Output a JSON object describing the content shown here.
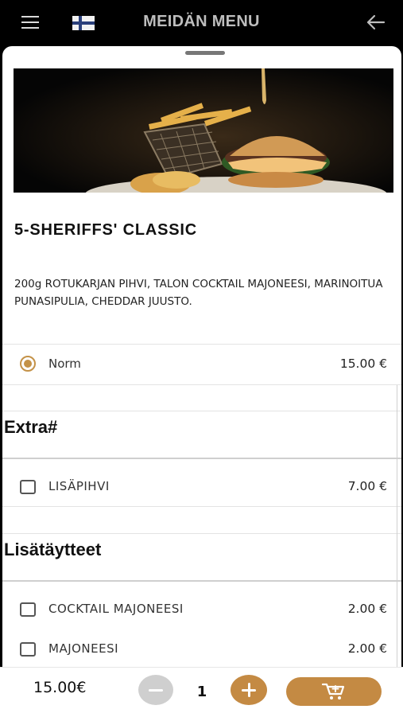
{
  "header": {
    "title": "MEIDÄN MENU",
    "menu_icon": "hamburger-menu-icon",
    "language_icon": "finland-flag-icon",
    "back_icon": "arrow-left-icon"
  },
  "product": {
    "image": "burger-and-fries-photo",
    "title": "5-SHERIFFS' CLASSIC",
    "description": "200g ROTUKARJAN PIHVI, TALON COCKTAIL MAJONEESI, MARINOITUA PUNASIPULIA, CHEDDAR JUUSTO."
  },
  "size_options": [
    {
      "label": "Norm",
      "price": "15.00 €",
      "selected": true
    }
  ],
  "sections": [
    {
      "title": "Extra#",
      "options": [
        {
          "label": "LISÄPIHVI",
          "price": "7.00 €",
          "checked": false
        }
      ]
    },
    {
      "title": "Lisätäytteet",
      "options": [
        {
          "label": "COCKTAIL MAJONEESI",
          "price": "2.00 €",
          "checked": false
        },
        {
          "label": "MAJONEESI",
          "price": "2.00 €",
          "checked": false
        }
      ]
    }
  ],
  "footer": {
    "total": "15.00€",
    "quantity": "1",
    "minus_icon": "minus-icon",
    "plus_icon": "plus-icon",
    "cart_icon": "add-to-cart-icon"
  },
  "colors": {
    "accent": "#c48a43",
    "header_bg": "#000000",
    "disabled": "#cfcfcf"
  }
}
